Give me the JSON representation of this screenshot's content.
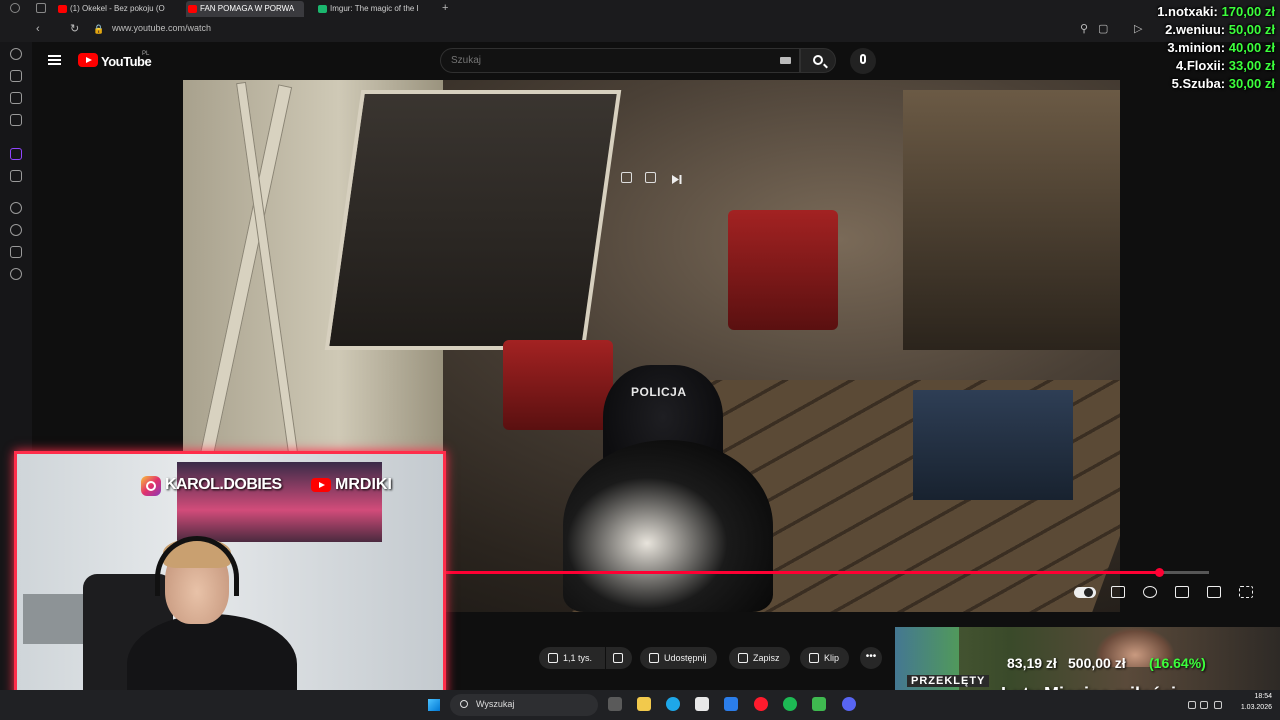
{
  "browser": {
    "tabs": [
      {
        "label": "(1) Okekel - Bez pokoju (O",
        "favicon_color": "#ff0000"
      },
      {
        "label": "FAN POMAGA W PORWA",
        "favicon_color": "#ff0000"
      },
      {
        "label": "Imgur: The magic of the I",
        "favicon_color": "#1bb76e"
      }
    ],
    "new_tab": "+",
    "url": "www.youtube.com/watch"
  },
  "youtube": {
    "wordmark": "YouTube",
    "country": "PL",
    "search_placeholder": "Szukaj",
    "video_text": "POLICJA",
    "progress": 0.935,
    "actions": {
      "like_count": "1,1 tys.",
      "share": "Udostępnij",
      "save": "Zapisz",
      "clip": "Klip",
      "more": "•••"
    }
  },
  "leaderboard": [
    {
      "rank": "1.",
      "name": "notxaki:",
      "amount": "170,00 zł"
    },
    {
      "rank": "2.",
      "name": "weniuu:",
      "amount": "50,00 zł"
    },
    {
      "rank": "3.",
      "name": "minion:",
      "amount": "40,00 zł"
    },
    {
      "rank": "4.",
      "name": "Floxii:",
      "amount": "33,00 zł"
    },
    {
      "rank": "5.",
      "name": "Szuba:",
      "amount": "30,00 zł"
    }
  ],
  "webcam": {
    "instagram_handle": "KAROL.DOBIES",
    "youtube_handle": "MRDIKI"
  },
  "goal": {
    "current": "83,19 zł",
    "target": "500,00 zł",
    "percent_label": "(16.64%)",
    "percent": 0.1664,
    "title": "Luty Miesiąc miłości",
    "sign": "PRZEKLĘTY"
  },
  "taskbar": {
    "search_label": "Wyszukaj",
    "time": "18:54",
    "date": "1.03.2026"
  },
  "colors": {
    "accent_red": "#ff0033",
    "cam_border": "#ff2d4a",
    "donation_green": "#3cff3c"
  }
}
